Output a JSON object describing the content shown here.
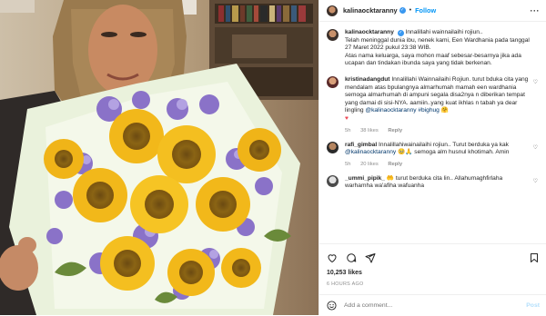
{
  "post": {
    "username": "kalinaocktaranny",
    "follow_label": "Follow",
    "separator": "•",
    "more_label": "···",
    "icons": {
      "verified": "verified-badge-icon",
      "more": "more-options-icon"
    }
  },
  "caption": {
    "username": "kalinaocktaranny",
    "line1": "Innalillahi wainnailaihi rojiun..",
    "line2": "Telah meninggal dunia ibu, nenek kami, Een Wardhania pada tanggal 27 Maret 2022 pukul 23:38 WIB.",
    "line3": "Atas nama keluarga, saya mohon maaf sebesar-besarnya jika ada ucapan dan tindakan ibunda saya yang tidak berkenan."
  },
  "comments": [
    {
      "username": "kristinadangdut",
      "text": "Innalillahi Wainnailaihi Rojiun. turut bduka cita yang mendalam atas bpulangnya almarhumah mamah een wardhania semoga almarhumah di ampuni segala disa2nya n diberikan tempat yang damai di sisi-NYA. aamiin..yang kuat ikhlas n tabah ya dear lingling",
      "mention": "@kalinaocktaranny #bighug",
      "emoji": "🤗",
      "heart": "♥",
      "time": "5h",
      "likes": "38 likes",
      "reply": "Reply"
    },
    {
      "username": "rafi_gimbal",
      "text": "Innalillahiwainailaihi rojiun.. Turut berduka ya kak",
      "mention": "@kalinaocktaranny",
      "emoji": "🥺🙏",
      "text2": "semoga alm husnul khotimah. Amin",
      "time": "5h",
      "likes": "20 likes",
      "reply": "Reply"
    },
    {
      "username": "_ummi_pipik_",
      "emoji": "🤲",
      "text": "turut berduka cita lin.. Allahumaghfirlaha warhamha wa'afiha wafuanha"
    }
  ],
  "stats": {
    "likes": "10,253 likes",
    "ago": "6 HOURS AGO"
  },
  "composer": {
    "placeholder": "Add a comment...",
    "post_label": "Post"
  },
  "action_icons": [
    "heart-icon",
    "comment-icon",
    "share-icon",
    "bookmark-icon"
  ],
  "colors": {
    "accent": "#0095f6",
    "verified": "#3897f0",
    "heart": "#ed4956",
    "muted": "#8e8e8e",
    "post_disabled": "#b2dffc"
  }
}
